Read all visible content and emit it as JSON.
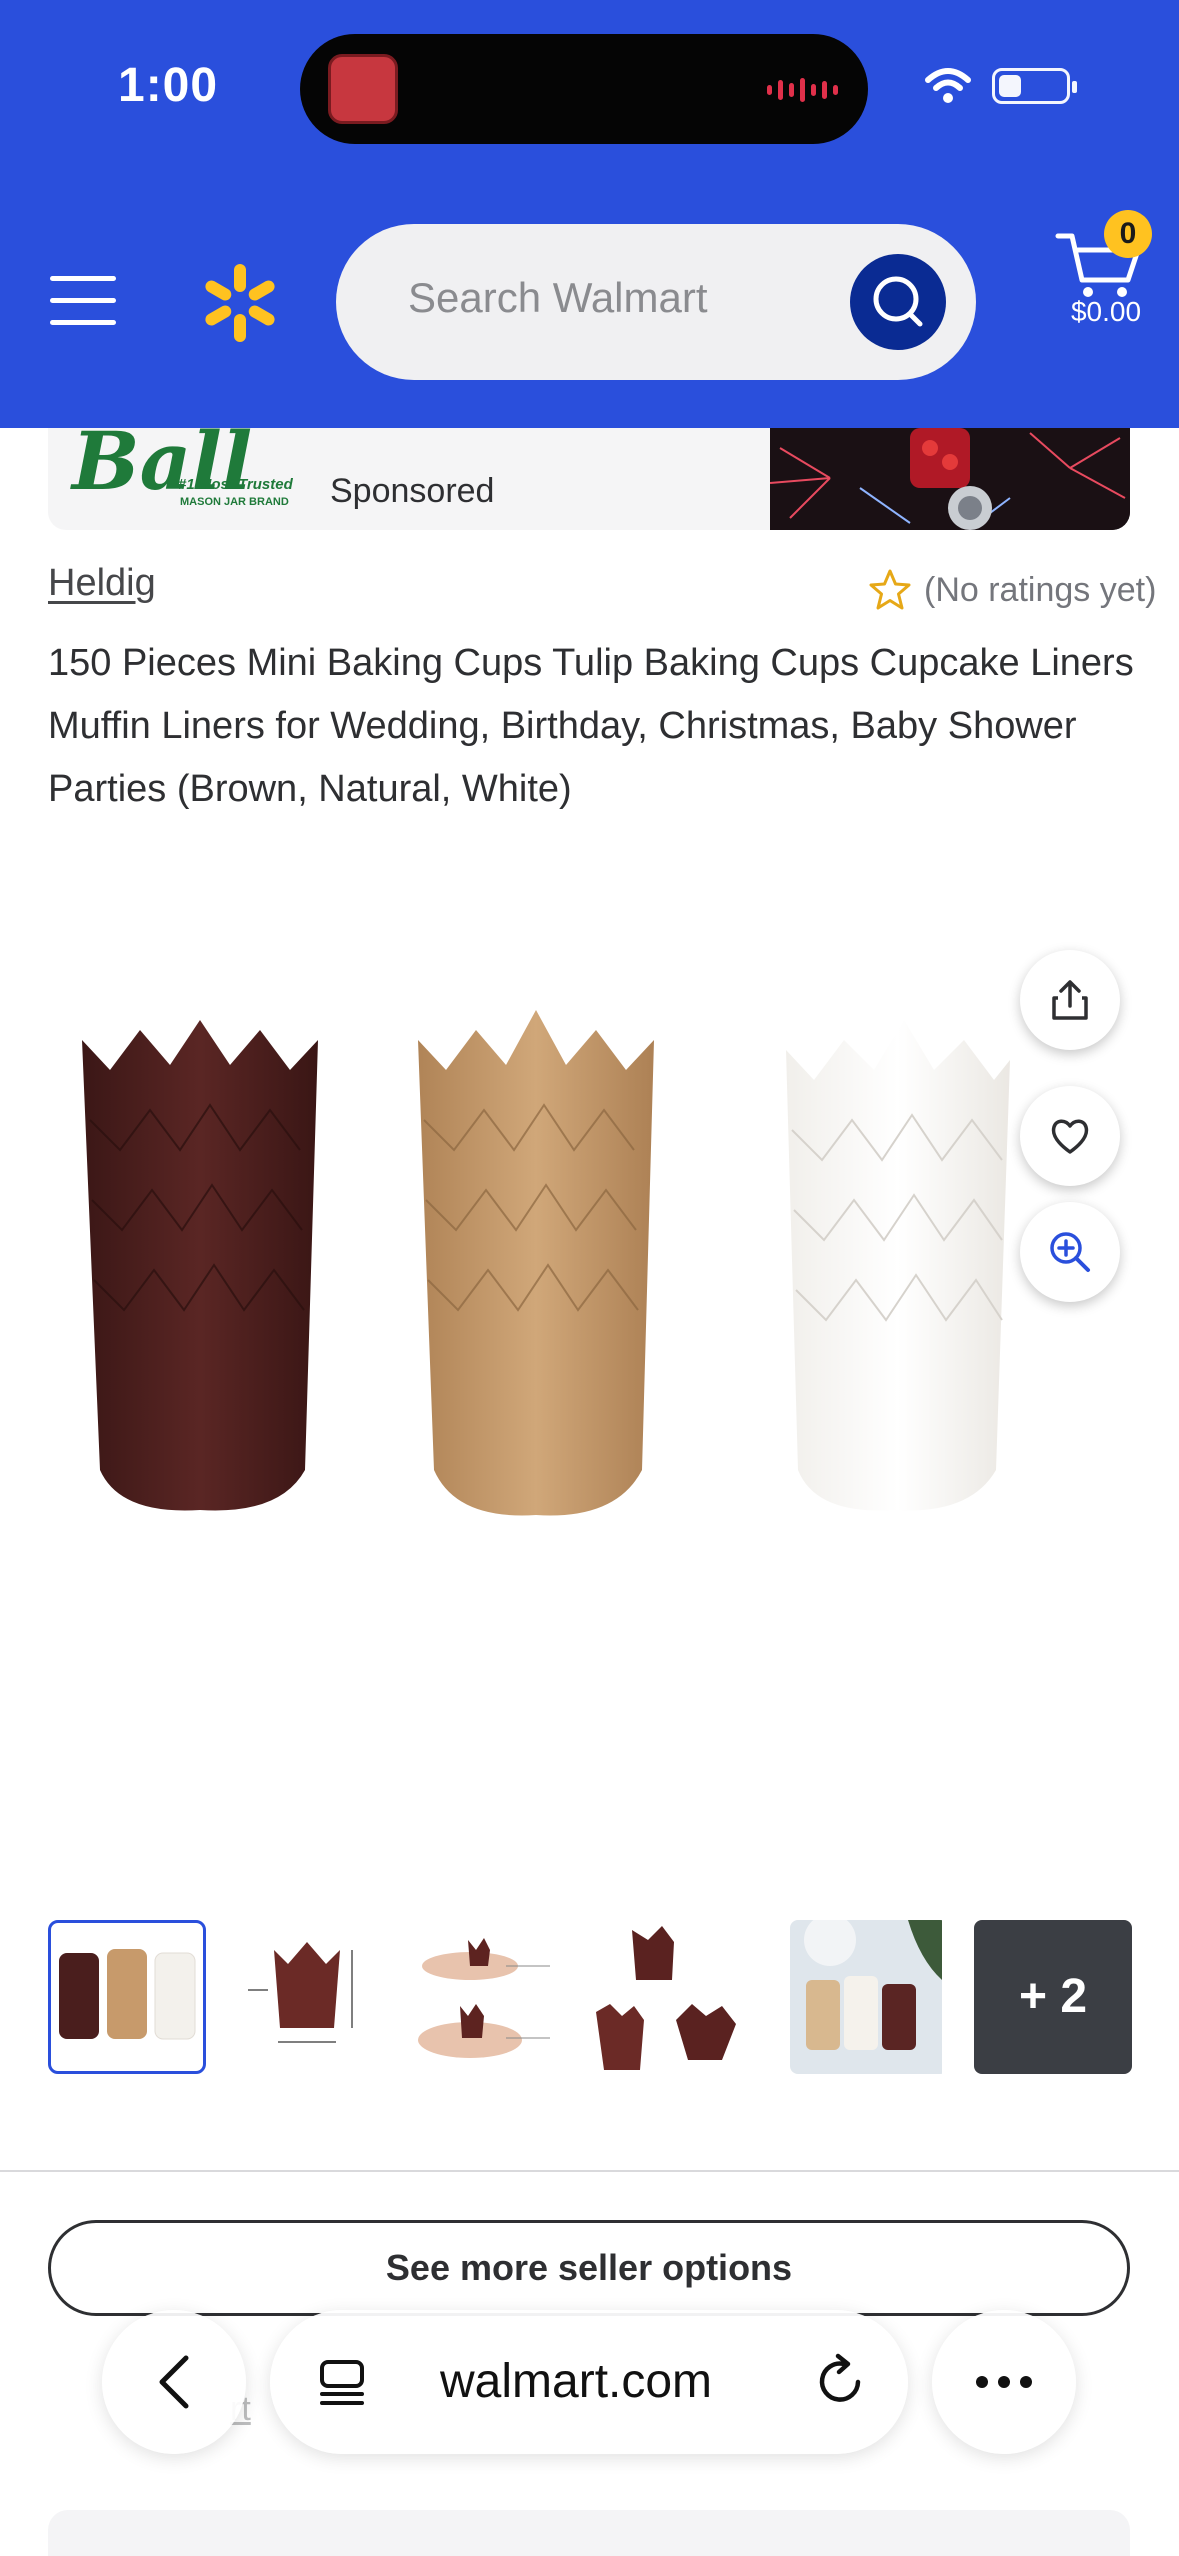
{
  "status_bar": {
    "time": "1:00"
  },
  "header": {
    "search_placeholder": "Search Walmart",
    "cart_count": "0",
    "cart_total": "$0.00",
    "brand_color": "#2a4fdc",
    "spark_color": "#ffc220"
  },
  "sponsored_banner": {
    "logo_text": "Ball",
    "tagline": "#1 Most Trusted",
    "subline": "MASON JAR BRAND",
    "label": "Sponsored"
  },
  "product": {
    "brand": "Heldig",
    "rating_text": "(No ratings yet)",
    "title": "150 Pieces Mini Baking Cups Tulip Baking Cups Cupcake Liners Muffin Liners for Wedding, Birthday, Christmas, Baby Shower Parties (Brown, Natural, White)",
    "image_actions": [
      "share-icon",
      "heart-icon",
      "zoom-icon"
    ],
    "thumbnails": [
      {
        "icon": "thumb-liners-three-colors",
        "selected": true
      },
      {
        "icon": "thumb-brown-liner-dimensions",
        "selected": false
      },
      {
        "icon": "thumb-liners-in-hand",
        "selected": false
      },
      {
        "icon": "thumb-brown-liners-scattered",
        "selected": false
      },
      {
        "icon": "thumb-liners-lifestyle",
        "selected": false
      }
    ],
    "more_images_label": "+ 2"
  },
  "seller_button_label": "See more seller options",
  "faded_row_text": "rt",
  "browser": {
    "url": "walmart.com"
  }
}
